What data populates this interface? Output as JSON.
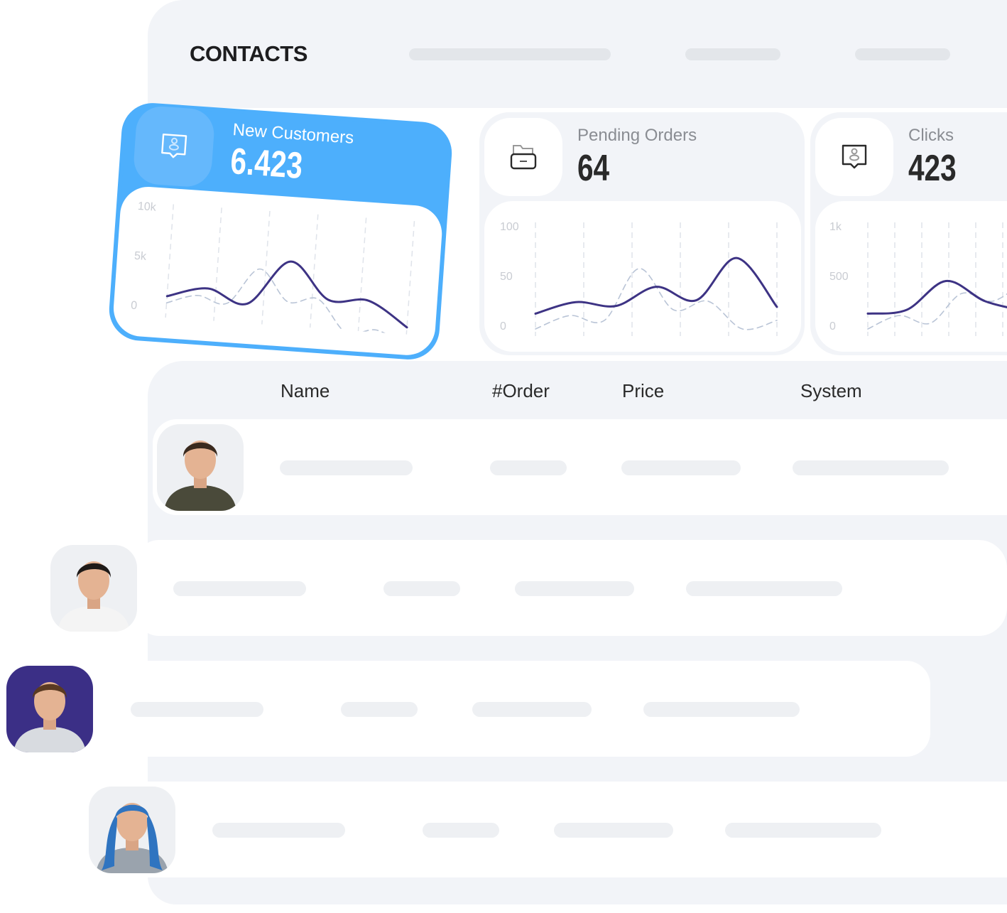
{
  "header": {
    "title": "CONTACTS"
  },
  "cards": [
    {
      "label": "New Customers",
      "value": "6.423",
      "icon": "user-chat-icon",
      "accent": "#4daffc",
      "yticks": [
        "10k",
        "5k",
        "0"
      ],
      "ymax": 10000,
      "series_solid": [
        1500,
        2600,
        1300,
        6000,
        2300,
        2500,
        0
      ],
      "series_dashed": [
        800,
        1800,
        1200,
        5000,
        1800,
        2300,
        -1000,
        -500,
        -2000
      ]
    },
    {
      "label": "Pending Orders",
      "value": "64",
      "icon": "folder-icon",
      "yticks": [
        "100",
        "50",
        "0"
      ],
      "ymax": 100,
      "series_solid": [
        16,
        28,
        24,
        44,
        30,
        74,
        23
      ],
      "series_dashed": [
        0,
        14,
        9,
        63,
        20,
        29,
        0,
        9
      ]
    },
    {
      "label": "Clicks",
      "value": "423",
      "icon": "user-chat-icon",
      "yticks": [
        "1k",
        "500",
        "0"
      ],
      "ymax": 1000,
      "series_solid": [
        160,
        200,
        500,
        290,
        190
      ],
      "series_dashed": [
        0,
        140,
        60,
        370,
        290,
        500
      ]
    }
  ],
  "colors": {
    "line": "#3d3384",
    "dashed": "#b9c4d6",
    "panel": "#f2f4f8",
    "accent": "#4daffc"
  },
  "table": {
    "columns": [
      "Name",
      "#Order",
      "Price",
      "System"
    ],
    "rows": [
      {
        "avatar": "man-curly-hair",
        "bg": "#eef0f3"
      },
      {
        "avatar": "man-tie",
        "bg": "#eef0f3"
      },
      {
        "avatar": "man-smiling",
        "bg": "#3b2f86"
      },
      {
        "avatar": "woman-blue-hair",
        "bg": "#eef0f3"
      }
    ]
  }
}
